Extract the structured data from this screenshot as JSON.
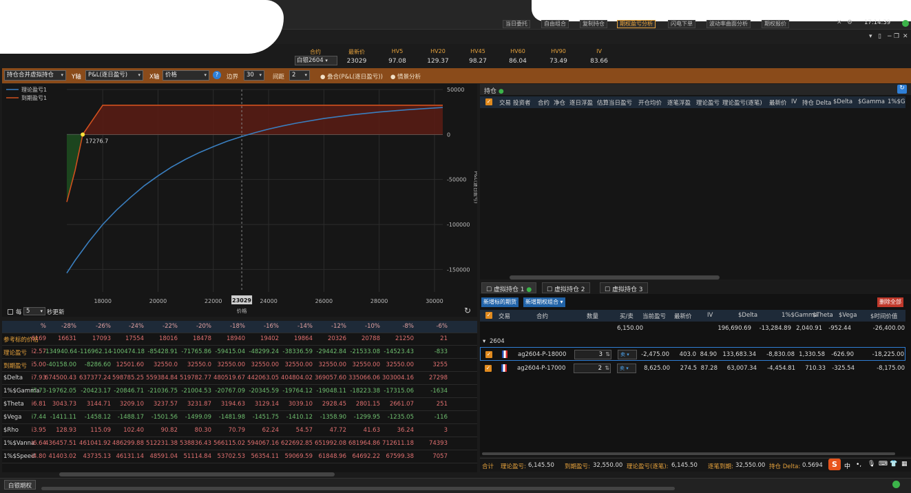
{
  "topbar": {
    "buttons": [
      "当日委托",
      "自由组合",
      "复制持仓",
      "期权盈亏分析",
      "闪电下单",
      "波动率曲面分析",
      "期权报价"
    ],
    "active_index": 3,
    "clock": "17:14:39"
  },
  "quote": {
    "headers": [
      "合约",
      "最新价",
      "HV5",
      "HV20",
      "HV45",
      "HV60",
      "HV90",
      "IV"
    ],
    "contract": "白银2604",
    "values": [
      "23029",
      "97.08",
      "129.37",
      "98.27",
      "86.04",
      "73.49",
      "83.66"
    ]
  },
  "toolbar": {
    "mode": "持仓合并虚拟持仓",
    "y_label": "Y轴",
    "y_value": "P&L(逐日盈亏)",
    "x_label": "X轴",
    "x_value": "价格",
    "help": "?",
    "edge_label": "边界",
    "edge_value": "30",
    "step_label": "间距",
    "step_value": "2",
    "opt1": "叠合(P&L(逐日盈亏))",
    "opt2": "情景分析"
  },
  "chart": {
    "legend": [
      "理论盈亏1",
      "到期盈亏1"
    ],
    "y_axis_title": "P&L(逐日盈亏)",
    "x_axis_title": "价格",
    "y_ticks": [
      "50000",
      "0",
      "-50000",
      "-100000",
      "-150000"
    ],
    "x_ticks": [
      "18000",
      "20000",
      "22000",
      "24000",
      "26000",
      "28000",
      "30000"
    ],
    "current_price_label": "23029",
    "point_label": "17276.7",
    "refresh_label": "每",
    "refresh_value": "5",
    "refresh_unit": "秒更新"
  },
  "chart_data": {
    "type": "line",
    "xlabel": "价格",
    "ylabel": "P&L(逐日盈亏)",
    "xlim": [
      16700,
      30300
    ],
    "ylim": [
      -175000,
      50000
    ],
    "series": [
      {
        "name": "理论盈亏1",
        "color": "#3a7fc0",
        "x": [
          16700,
          17000,
          17500,
          18000,
          18500,
          19000,
          19500,
          20000,
          20500,
          21000,
          21500,
          22000,
          22500,
          23000,
          23500,
          24000,
          24500,
          25000,
          26000,
          27000,
          28000,
          29000,
          30000,
          30300
        ],
        "y": [
          -154000,
          -140000,
          -119000,
          -100000,
          -84000,
          -70000,
          -57000,
          -46000,
          -36000,
          -27500,
          -20000,
          -13500,
          -7500,
          -2500,
          2000,
          6000,
          9500,
          12600,
          17800,
          21800,
          25000,
          27500,
          29500,
          30000
        ]
      },
      {
        "name": "到期盈亏1",
        "color": "#d0501e",
        "x": [
          16700,
          17000,
          17276.7,
          18000,
          30300
        ],
        "y": [
          -75000,
          -40000,
          0,
          32550,
          32550
        ]
      }
    ],
    "marker": {
      "x": 17276.7,
      "y": 0
    },
    "current_price": 23029
  },
  "greeks": {
    "header": [
      "%",
      "-28%",
      "-26%",
      "-24%",
      "-22%",
      "-20%",
      "-18%",
      "-16%",
      "-14%",
      "-12%",
      "-10%",
      "-8%",
      "-6%"
    ],
    "rows": [
      {
        "label": "参考标的价格",
        "color": "#e07070",
        "values": [
          "6169",
          "16631",
          "17093",
          "17554",
          "18016",
          "18478",
          "18940",
          "19402",
          "19864",
          "20326",
          "20788",
          "21250",
          "21"
        ]
      },
      {
        "label": "理论盈亏",
        "color": "#e07070",
        "values": [
          "i2.57",
          "-134940.64",
          "-116962.14",
          "-100474.18",
          "-85428.91",
          "-71765.86",
          "-59415.04",
          "-48299.24",
          "-38336.59",
          "-29442.84",
          "-21533.08",
          "-14523.43",
          "-833"
        ]
      },
      {
        "label": "到期盈亏",
        "color": "#e07070",
        "values": [
          "i5.00",
          "-40158.00",
          "-8286.60",
          "12501.60",
          "32550.0",
          "32550.0",
          "32550.00",
          "32550.00",
          "32550.00",
          "32550.00",
          "32550.00",
          "32550.00",
          "3255"
        ]
      },
      {
        "label": "$Delta",
        "color": "#e07070",
        "values": [
          "i7.93",
          "674500.43",
          "637377.24",
          "598785.25",
          "559384.84",
          "519782.77",
          "480519.67",
          "442063.05",
          "404804.02",
          "369057.60",
          "335066.06",
          "303004.16",
          "27298"
        ]
      },
      {
        "label": "1%$Gamma",
        "color": "#6fbf6f",
        "values": [
          "i7.73",
          "-19762.05",
          "-20423.17",
          "-20846.71",
          "-21036.75",
          "-21004.53",
          "-20767.09",
          "-20345.59",
          "-19764.12",
          "-19048.11",
          "-18223.38",
          "-17315.06",
          "-1634"
        ]
      },
      {
        "label": "$Theta",
        "color": "#e07070",
        "values": [
          "i6.81",
          "3043.73",
          "3144.71",
          "3209.10",
          "3237.57",
          "3231.87",
          "3194.63",
          "3129.14",
          "3039.10",
          "2928.45",
          "2801.15",
          "2661.07",
          "251"
        ]
      },
      {
        "label": "$Vega",
        "color": "#6fbf6f",
        "values": [
          "i7.44",
          "-1411.11",
          "-1458.12",
          "-1488.17",
          "-1501.56",
          "-1499.09",
          "-1481.98",
          "-1451.75",
          "-1410.12",
          "-1358.90",
          "-1299.95",
          "-1235.05",
          "-116"
        ]
      },
      {
        "label": "$Rho",
        "color": "#e07070",
        "values": [
          "i3.95",
          "128.93",
          "115.09",
          "102.40",
          "90.82",
          "80.30",
          "70.79",
          "62.24",
          "54.57",
          "47.72",
          "41.63",
          "36.24",
          "3"
        ]
      },
      {
        "label": "1%$Vanna",
        "color": "#e07070",
        "values": [
          "i6.64",
          "436457.51",
          "461041.92",
          "486299.88",
          "512231.38",
          "538836.43",
          "566115.02",
          "594067.16",
          "622692.85",
          "651992.08",
          "681964.86",
          "712611.18",
          "74393"
        ]
      },
      {
        "label": "1%$Speed",
        "color": "#e07070",
        "values": [
          "i4.80",
          "41403.02",
          "43735.13",
          "46131.14",
          "48591.04",
          "51114.84",
          "53702.53",
          "56354.11",
          "59069.59",
          "61848.96",
          "64692.22",
          "67599.38",
          "7057"
        ]
      }
    ]
  },
  "positions": {
    "tab": "持仓",
    "columns": [
      "交易",
      "投资者",
      "合约",
      "净仓",
      "逐日浮盈",
      "估算当日盈亏",
      "开仓均价",
      "逐笔浮盈",
      "理论盈亏",
      "理论盈亏(逐笔)",
      "最新价",
      "IV",
      "持仓 Delta",
      "$Delta",
      "$Gamma",
      "1%$G"
    ]
  },
  "virtual": {
    "tabs": [
      "虚拟持仓 1",
      "虚拟持仓 2",
      "虚拟持仓 3"
    ],
    "btn_add_underlying": "新增标的期货",
    "btn_add_combo": "新增期权组合",
    "btn_delete_all": "删除全部",
    "columns": [
      "交易",
      "合约",
      "数量",
      "买/卖",
      "当前盈亏",
      "最新价",
      "IV",
      "$Delta",
      "1%$Gamma",
      "$Theta",
      "$Vega",
      "$时间价值"
    ],
    "summary": [
      "6,150.00",
      "196,690.69",
      "-13,284.89",
      "2,040.91",
      "-952.44",
      "-26,400.00"
    ],
    "group": "2604",
    "rows": [
      {
        "contract": "ag2604-P-18000",
        "qty": "3",
        "pnl": "-2,475.00",
        "last": "403.0",
        "iv": "84.90",
        "delta": "133,683.34",
        "gamma": "-8,830.08",
        "theta": "1,330.58",
        "vega": "-626.90",
        "tv": "-18,225.00"
      },
      {
        "contract": "ag2604-P-17000",
        "qty": "2",
        "pnl": "8,625.00",
        "last": "274.5",
        "iv": "87.28",
        "delta": "63,007.34",
        "gamma": "-4,454.81",
        "theta": "710.33",
        "vega": "-325.54",
        "tv": "-8,175.00"
      }
    ]
  },
  "footer": {
    "total": "合计",
    "theory_label": "理论盈亏:",
    "theory_value": "6,145.50",
    "expiry_label": "到期盈亏:",
    "expiry_value": "32,550.00",
    "theory_tick_label": "理论盈亏(逐笔):",
    "theory_tick_value": "6,145.50",
    "tick_expiry_label": "逐笔到期:",
    "tick_expiry_value": "32,550.00",
    "delta_label": "持仓 Delta:",
    "delta_value": "0.5694"
  },
  "status": {
    "bottom_tab": "白银期权",
    "ime": "中"
  }
}
